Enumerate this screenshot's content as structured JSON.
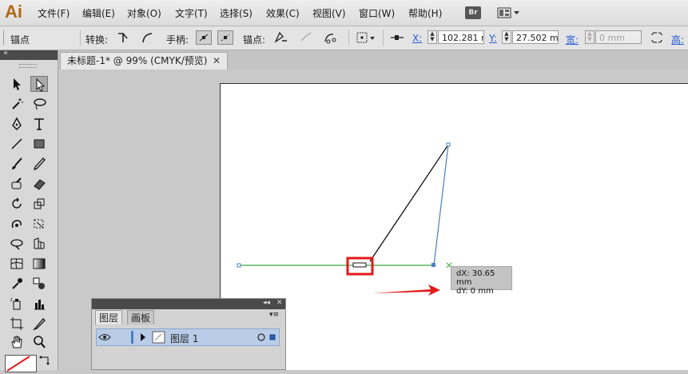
{
  "app": {
    "logo": "Ai",
    "bridge": "Br"
  },
  "menu": [
    "文件(F)",
    "编辑(E)",
    "对象(O)",
    "文字(T)",
    "选择(S)",
    "效果(C)",
    "视图(V)",
    "窗口(W)",
    "帮助(H)"
  ],
  "control": {
    "mode_label": "锚点",
    "convert_label": "转换:",
    "handles_label": "手柄:",
    "anchors_label": "锚点:",
    "x_label": "X:",
    "x_value": "102.281",
    "x_unit_tail": "m",
    "y_label": "Y:",
    "y_value": "27.502",
    "y_unit_tail": "m",
    "w_label": "宽:",
    "w_value": "0 mm",
    "h_label": "高:"
  },
  "document": {
    "tab_title": "未标题-1* @ 99% (CMYK/预览)",
    "close": "✕"
  },
  "tooltip": {
    "dx": "dX: 30.65 mm",
    "dy": "dY: 0 mm"
  },
  "layers_panel": {
    "tab_layers": "图层",
    "tab_artboards": "画板",
    "layer_name": "图层 1"
  },
  "colors": {
    "accent_red": "#e11b1b",
    "path_green": "#3aa83a",
    "path_blue": "#4a7fc0",
    "selection_row": "#b9cde8"
  }
}
